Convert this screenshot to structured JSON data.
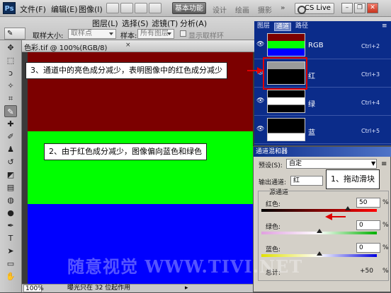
{
  "app": {
    "logo": "Ps",
    "menus": [
      "文件(F)",
      "编辑(E)",
      "图像(I)",
      "图层(L)",
      "选择(S)",
      "滤镜(T)",
      "分析(A)"
    ],
    "workspace_active": "基本功能",
    "workspaces": [
      "设计",
      "绘画",
      "摄影"
    ],
    "cs_live": "CS Live"
  },
  "options": {
    "tool_icon": "✎",
    "sample_size_label": "取样大小:",
    "sample_size_value": "取样点",
    "sample_label": "样本:",
    "sample_value": "所有图层",
    "show_ring": "显示取样环"
  },
  "document": {
    "tab_title": "色彩.tif @ 100%(RGB/8)",
    "zoom": "100%",
    "status": "曝光只在 32 位起作用",
    "bands": [
      "#7c0000",
      "#00ff00",
      "#0000ff"
    ]
  },
  "channels": {
    "tabs": [
      "图层",
      "通道",
      "路径"
    ],
    "rows": [
      {
        "name": "RGB",
        "key": "Ctrl+2"
      },
      {
        "name": "红",
        "key": "Ctrl+3"
      },
      {
        "name": "绿",
        "key": "Ctrl+4"
      },
      {
        "name": "蓝",
        "key": "Ctrl+5"
      }
    ]
  },
  "mixer": {
    "title": "通道混和器",
    "preset_label": "预设(S):",
    "preset_value": "自定",
    "output_label": "输出通道:",
    "output_value": "红",
    "source_label": "源通道",
    "sliders": [
      {
        "label": "红色:",
        "value": "50",
        "level": 0.75
      },
      {
        "label": "绿色:",
        "value": "0",
        "level": 0.5
      },
      {
        "label": "蓝色:",
        "value": "0",
        "level": 0.5
      }
    ],
    "total_label": "总计:",
    "total_value": "+50",
    "percent": "%"
  },
  "callouts": {
    "c3": "3、通道中的亮色成分减少，表明图像中的红色成分减少",
    "c2": "2、由于红色成分减少，图像偏向蓝色和绿色",
    "c1": "1、拖动滑块"
  },
  "watermark": "随意视觉 WWW.TIVI.NET",
  "colors": {
    "accent_red": "#e00000",
    "channel_panel": "#0b2c8a"
  }
}
